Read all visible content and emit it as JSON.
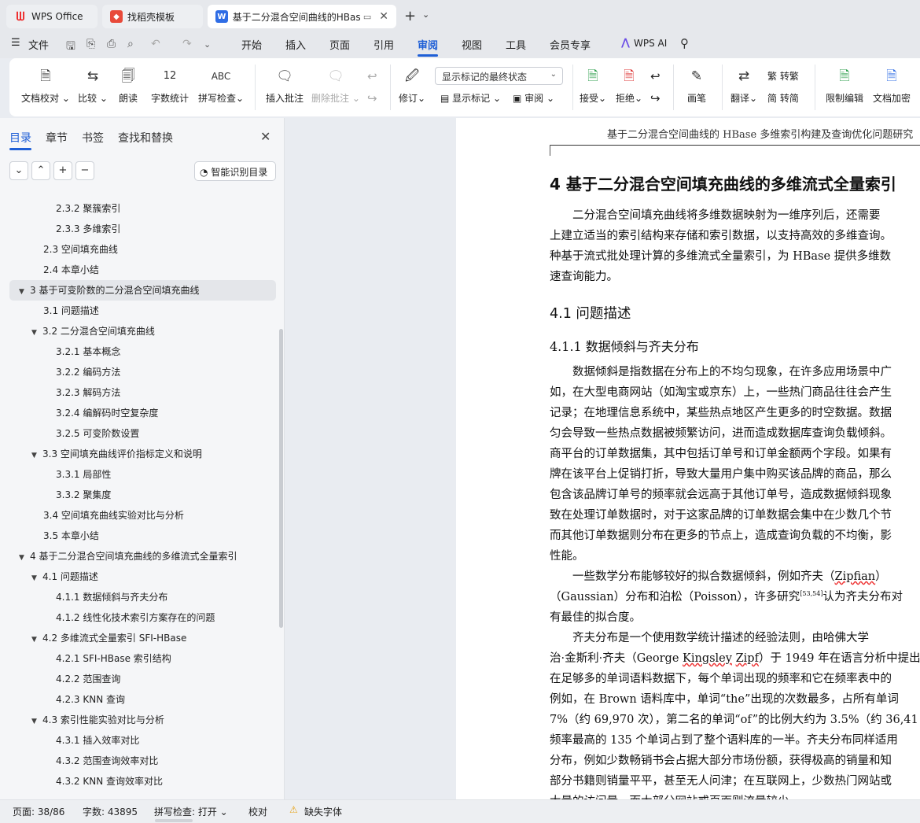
{
  "tabs": {
    "wps_office": "WPS Office",
    "template": "找稻壳模板",
    "document": "基于二分混合空间曲线的HBase多维索引构建及查询优化问题研究",
    "add": "+",
    "more": "⌄",
    "close": "✕"
  },
  "menu": {
    "file": "文件",
    "start": "开始",
    "insert": "插入",
    "page": "页面",
    "reference": "引用",
    "review": "审阅",
    "view": "视图",
    "tools": "工具",
    "member": "会员专享",
    "wps_ai": "WPS AI"
  },
  "ribbon": {
    "doc_proof": "文档校对",
    "compare": "比较",
    "read_aloud": "朗读",
    "word_count": "字数统计",
    "word_count_icon_text": "12",
    "spell_check": "拼写检查",
    "spell_icon_text": "ABC",
    "insert_comment": "插入批注",
    "delete_comment": "删除批注",
    "revise": "修订",
    "track_mode": "显示标记的最终状态",
    "show_markup": "显示标记",
    "review_pane": "审阅",
    "accept": "接受",
    "reject": "拒绝",
    "pen": "画笔",
    "translate": "翻译",
    "to_traditional": "转繁",
    "to_simplified": "转简",
    "restrict_edit": "限制编辑",
    "doc_encrypt": "文档加密"
  },
  "panel": {
    "tabs": [
      "目录",
      "章节",
      "书签",
      "查找和替换"
    ],
    "smart_toc": "智能识别目录",
    "toc": [
      {
        "label": "2.3.2  聚簇索引"
      },
      {
        "label": "2.3.3  多维索引"
      },
      {
        "label": "2.3  空间填充曲线"
      },
      {
        "label": "2.4  本章小结"
      },
      {
        "label": "3  基于可变阶数的二分混合空间填充曲线"
      },
      {
        "label": "3.1  问题描述"
      },
      {
        "label": "3.2  二分混合空间填充曲线"
      },
      {
        "label": "3.2.1  基本概念"
      },
      {
        "label": "3.2.2  编码方法"
      },
      {
        "label": "3.2.3  解码方法"
      },
      {
        "label": "3.2.4  编解码时空复杂度"
      },
      {
        "label": "3.2.5  可变阶数设置"
      },
      {
        "label": "3.3  空间填充曲线评价指标定义和说明"
      },
      {
        "label": "3.3.1  局部性"
      },
      {
        "label": "3.3.2  聚集度"
      },
      {
        "label": "3.4  空间填充曲线实验对比与分析"
      },
      {
        "label": "3.5  本章小结"
      },
      {
        "label": "4  基于二分混合空间填充曲线的多维流式全量索引"
      },
      {
        "label": "4.1  问题描述"
      },
      {
        "label": "4.1.1  数据倾斜与齐夫分布"
      },
      {
        "label": "4.1.2  线性化技术索引方案存在的问题"
      },
      {
        "label": "4.2 多维流式全量索引 SFI-HBase"
      },
      {
        "label": "4.2.1 SFI-HBase 索引结构"
      },
      {
        "label": "4.2.2  范围查询"
      },
      {
        "label": "4.2.3 KNN 查询"
      },
      {
        "label": "4.3 索引性能实验对比与分析"
      },
      {
        "label": "4.3.1  插入效率对比"
      },
      {
        "label": "4.3.2  范围查询效率对比"
      },
      {
        "label": "4.3.2 KNN 查询效率对比"
      }
    ]
  },
  "document": {
    "header": "基于二分混合空间曲线的 HBase 多维索引构建及查询优化问题研究",
    "h1": "4  基于二分混合空间填充曲线的多维流式全量索引",
    "para1": [
      "　　二分混合空间填充曲线将多维数据映射为一维序列后，还需要",
      "上建立适当的索引结构来存储和索引数据，以支持高效的多维查询。",
      "种基于流式批处理计算的多维流式全量索引，为 HBase 提供多维数",
      "速查询能力。"
    ],
    "h2": "4.1  问题描述",
    "h3": "4.1.1  数据倾斜与齐夫分布",
    "para2": [
      "　　数据倾斜是指数据在分布上的不均匀现象，在许多应用场景中广",
      "如，在大型电商网站（如淘宝或京东）上，一些热门商品往往会产生",
      "记录；在地理信息系统中，某些热点地区产生更多的时空数据。数据",
      "匀会导致一些热点数据被频繁访问，进而造成数据库查询负载倾斜。",
      "商平台的订单数据集，其中包括订单号和订单金额两个字段。如果有",
      "牌在该平台上促销打折，导致大量用户集中购买该品牌的商品，那么",
      "包含该品牌订单号的频率就会远高于其他订单号，造成数据倾斜现象",
      "致在处理订单数据时，对于这家品牌的订单数据会集中在少数几个节",
      "而其他订单数据则分布在更多的节点上，造成查询负载的不均衡，影",
      "性能。"
    ],
    "para3_l1_a": "　　一些数学分布能够较好的拟合数据倾斜，例如齐夫（",
    "para3_l1_b": "Zipfian",
    "para3_l1_c": "）",
    "para3_l2_a": "（Gaussian）分布和泊松（Poisson），许多研究",
    "para3_l2_cite": "[53,54]",
    "para3_l2_b": "认为齐夫分布对",
    "para3_l3": "有最佳的拟合度。",
    "para4_l1": "　　齐夫分布是一个使用数学统计描述的经验法则，由哈佛大学",
    "para4_l2_a": "治·金斯利·齐夫（George ",
    "para4_l2_b": "Kingsley",
    "para4_l2_c": " ",
    "para4_l2_d": "Zipf",
    "para4_l2_e": "）于 1949 年在语言分析中提出",
    "para4_rest": [
      "在足够多的单词语料数据下，每个单词出现的频率和它在频率表中的",
      "例如，在 Brown 语料库中，单词“the”出现的次数最多，占所有单词",
      "7%（约 69,970 次），第二名的单词“of”的比例大约为 3.5%（约 36,41",
      "频率最高的 135 个单词占到了整个语料库的一半。齐夫分布同样适用",
      "分布，例如少数畅销书会占据大部分市场份额，获得极高的销量和知",
      "部分书籍则销量平平，甚至无人问津；在互联网上，少数热门网站或",
      "大量的访问量，而大部分网站或页面则流量较少。"
    ]
  },
  "status": {
    "page": "页面: 38/86",
    "words": "字数: 43895",
    "spell": "拼写检查: 打开 ⌄",
    "proof": "校对",
    "missing_font": "缺失字体"
  },
  "colors": {
    "accent": "#1f5fd6",
    "wps_red": "#e22222",
    "ai_purple": "#6b4de6"
  }
}
